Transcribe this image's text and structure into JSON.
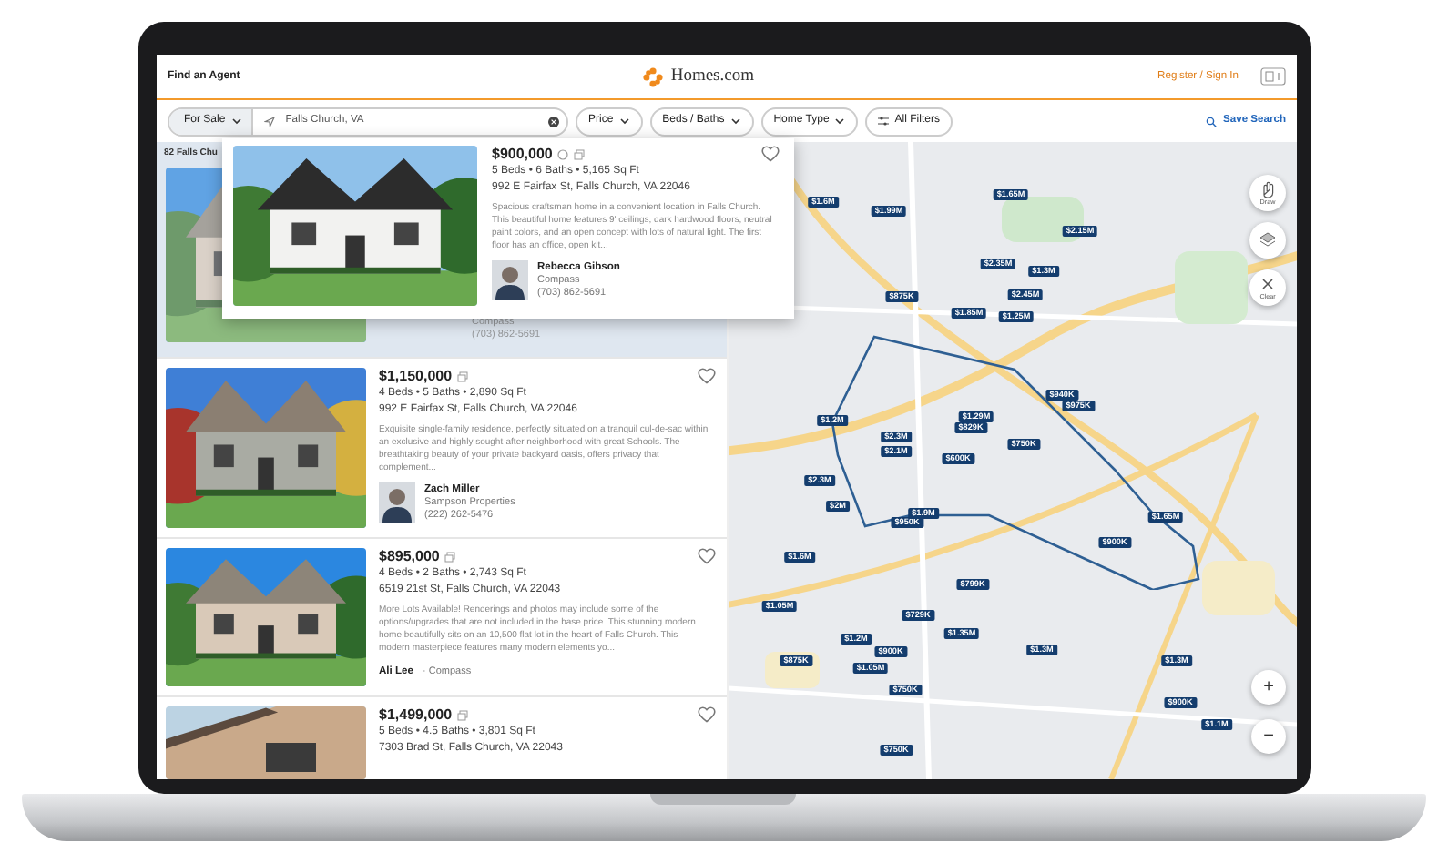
{
  "header": {
    "link": "Find an Agent",
    "logo": "Homes.com",
    "account": "Register / Sign In"
  },
  "filters": {
    "mode": "For Sale",
    "location": "Falls Church, VA",
    "buttons": [
      {
        "label": "Price",
        "kind": "dropdown"
      },
      {
        "label": "Beds / Baths",
        "kind": "dropdown"
      },
      {
        "label": "Home Type",
        "kind": "dropdown"
      },
      {
        "label": "All Filters",
        "kind": "filters"
      }
    ],
    "save": "Save Search"
  },
  "results_count": "82 Falls Chu",
  "hidden_card": {
    "company": "Compass",
    "phone": "(703) 862-5691"
  },
  "popup": {
    "price": "$900,000",
    "specs": "5 Beds • 6 Baths • 5,165 Sq Ft",
    "address": "992 E Fairfax St, Falls Church, VA 22046",
    "description": "Spacious craftsman home in a convenient location in Falls Church. This beautiful home features 9' ceilings, dark hardwood floors, neutral paint colors, and an open concept with lots of natural light. The first floor has an office, open kit...",
    "agent": "Rebecca Gibson",
    "company": "Compass",
    "phone": "(703) 862-5691"
  },
  "listings": [
    {
      "price": "$1,150,000",
      "specs": "4 Beds • 5 Baths • 2,890 Sq Ft",
      "address": "992 E Fairfax St, Falls Church, VA 22046",
      "description": "Exquisite single-family residence, perfectly situated on a tranquil cul-de-sac within an exclusive and highly sought-after neighborhood with great Schools. The breathtaking beauty of your private backyard oasis, offers privacy that complement...",
      "agent": "Zach Miller",
      "company": "Sampson Properties",
      "phone": "(222) 262-5476",
      "kind": "avatar"
    },
    {
      "price": "$895,000",
      "specs": "4 Beds • 2 Baths • 2,743 Sq Ft",
      "address": "6519 21st St, Falls Church, VA 22043",
      "description": "More Lots Available! Renderings and photos may include some of the options/upgrades that are not included in the base price. This stunning modern home beautifully sits on an 10,500 flat lot in the heart of Falls Church. This modern masterpiece features many modern elements yo...",
      "agent": "Ali Lee",
      "company": "· Compass",
      "kind": "inline"
    },
    {
      "price": "$1,499,000",
      "specs": "5 Beds • 4.5 Baths • 3,801 Sq Ft",
      "address": "7303 Brad St, Falls Church, VA 22043",
      "kind": "cut"
    }
  ],
  "map": {
    "pins": [
      "$1.6M",
      "$1.99M",
      "$1.65M",
      "$2.15M",
      "$2.35M",
      "$1.3M",
      "$2.45M",
      "$875K",
      "$1.85M",
      "$1.25M",
      "$1.2M",
      "$940K",
      "$975K",
      "$2.3M",
      "$2.1M",
      "$1.29M",
      "$829K",
      "$750K",
      "$600K",
      "$2.3M",
      "$2M",
      "$950K",
      "$1.9M",
      "$1.6M",
      "$900K",
      "$1.65M",
      "$1.05M",
      "$799K",
      "$729K",
      "$1.2M",
      "$1.35M",
      "$1.3M",
      "$900K",
      "$875K",
      "$1.05M",
      "$750K",
      "$1.3M",
      "$900K",
      "$1.1M",
      "$750K"
    ],
    "controls": [
      {
        "label": "Draw",
        "kind": "draw"
      },
      {
        "kind": "layers"
      },
      {
        "label": "Clear",
        "kind": "clear"
      }
    ],
    "zoom": [
      "+",
      "−"
    ]
  }
}
